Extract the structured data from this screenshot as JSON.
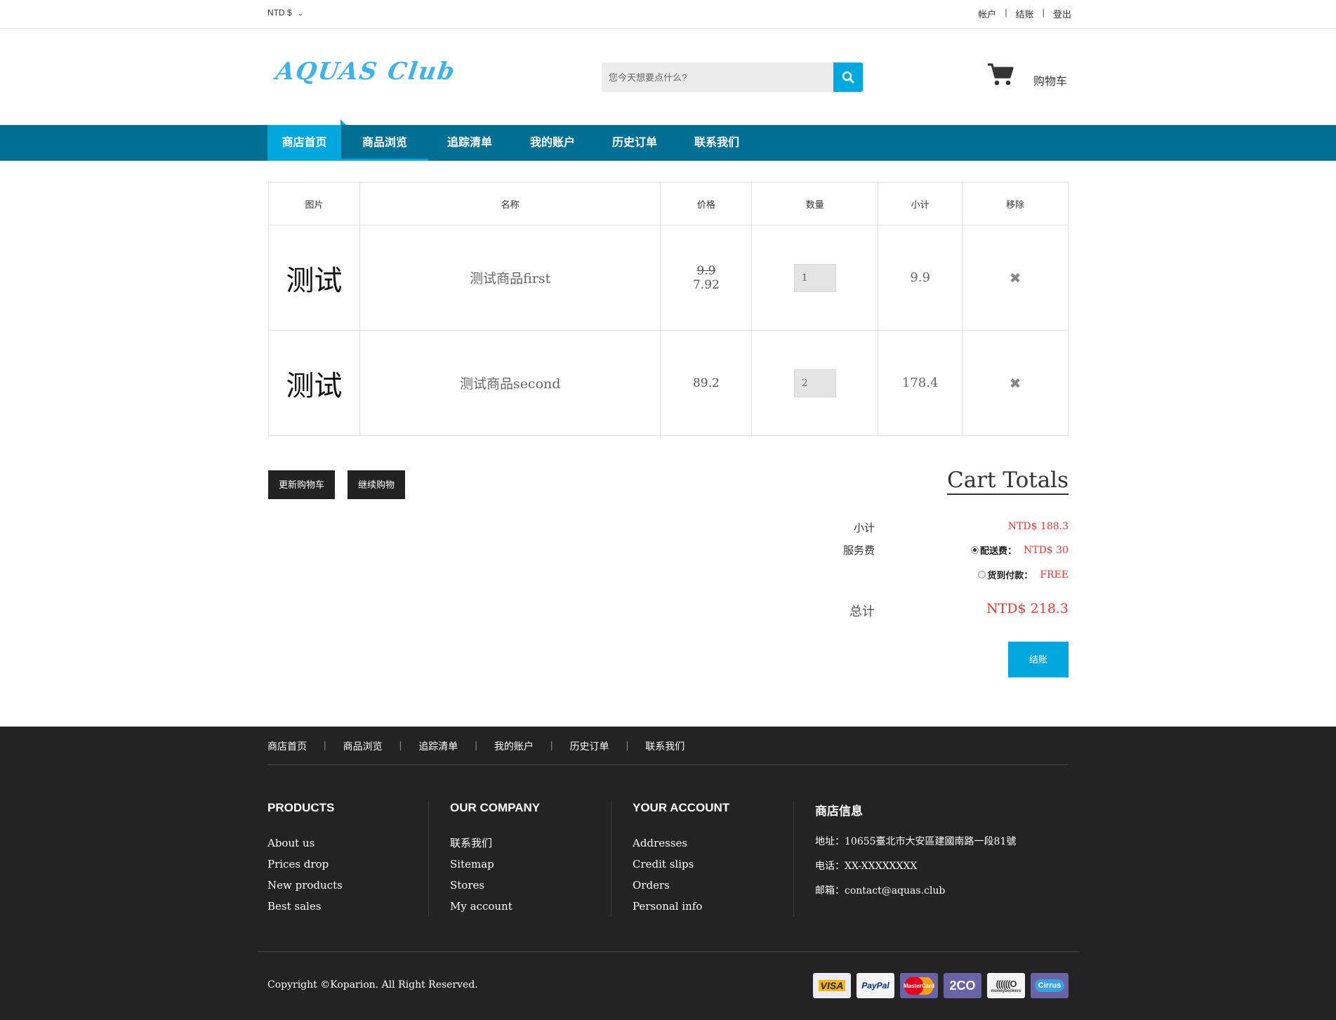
{
  "topbar": {
    "currency": "NTD $",
    "links": [
      "帐户",
      "结账",
      "登出"
    ]
  },
  "header": {
    "logo": "AQUAS Club",
    "search_placeholder": "您今天想要点什么?",
    "cart_label": "购物车"
  },
  "nav": {
    "items": [
      "商店首页",
      "商品浏览",
      "追踪清单",
      "我的账户",
      "历史订单",
      "联系我们"
    ]
  },
  "cart": {
    "headers": [
      "图片",
      "名称",
      "价格",
      "数量",
      "小计",
      "移除"
    ],
    "rows": [
      {
        "image_text": "测试",
        "name": "测试商品first",
        "old_price": "9.9",
        "price": "7.92",
        "qty": "1",
        "subtotal": "9.9"
      },
      {
        "image_text": "测试",
        "name": "测试商品second",
        "old_price": "",
        "price": "89.2",
        "qty": "2",
        "subtotal": "178.4"
      }
    ]
  },
  "buttons": {
    "update": "更新购物车",
    "continue": "继续购物",
    "checkout": "结账"
  },
  "totals": {
    "title": "Cart Totals",
    "subtotal_label": "小计",
    "subtotal_value": "NTD$ 188.3",
    "service_label": "服务费",
    "option_delivery_label": "配送费：",
    "option_delivery_value": "NTD$ 30",
    "option_cod_label": "货到付款：",
    "option_cod_value": "FREE",
    "total_label": "总计",
    "total_value": "NTD$ 218.3"
  },
  "footer": {
    "nav": [
      "商店首页",
      "商品浏览",
      "追踪清单",
      "我的账户",
      "历史订单",
      "联系我们"
    ],
    "products": {
      "title": "PRODUCTS",
      "items": [
        "About us",
        "Prices drop",
        "New products",
        "Best sales"
      ]
    },
    "company": {
      "title": "OUR COMPANY",
      "items": [
        "联系我们",
        "Sitemap",
        "Stores",
        "My account"
      ]
    },
    "account": {
      "title": "YOUR ACCOUNT",
      "items": [
        "Addresses",
        "Credit slips",
        "Orders",
        "Personal info"
      ]
    },
    "info": {
      "title": "商店信息",
      "address": "地址：10655臺北市大安區建國南路一段81號",
      "phone": "电话：XX-XXXXXXXX",
      "email": "邮箱：contact@aquas.club"
    },
    "copyright": "Copyright ©Koparion. All Right Reserved.",
    "payments": [
      "VISA",
      "PayPal",
      "MasterCard",
      "2CO",
      "moneybookers",
      "Cirrus"
    ]
  },
  "colors": {
    "accent": "#00a7df",
    "nav_bg": "#016f94",
    "price_red": "#e53a3a",
    "footer_bg": "#232323"
  }
}
